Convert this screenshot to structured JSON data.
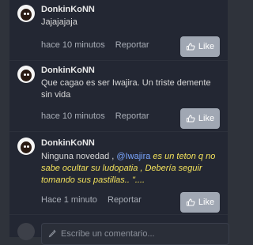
{
  "comments": [
    {
      "username": "DonkinKoNN",
      "text": "Jajajajaja",
      "time": "hace 10 minutos",
      "report": "Reportar",
      "like": "Like"
    },
    {
      "username": "DonkinKoNN",
      "text": "Que cagao es ser Iwajira. Un triste demente sin vida",
      "time": "hace 10 minutos",
      "report": "Reportar",
      "like": "Like"
    },
    {
      "username": "DonkinKoNN",
      "text_start": "Ninguna novedad , ",
      "mention": "@Iwajira",
      "highlight": " es un teton q no sabe ocultar su ludopatia , Debería seguir tomando sus pastillas.. \"....",
      "time": "Hace 1 minuto",
      "report": "Reportar",
      "like": "Like"
    }
  ],
  "compose": {
    "placeholder": "Escribe un comentario..."
  },
  "colors": {
    "background": "#232733",
    "like_button": "#a0a7b3",
    "mention": "#7aa6ff",
    "highlight": "#f2e15b"
  },
  "icons": {
    "like": "thumbs-up-icon",
    "compose": "pencil-icon"
  }
}
